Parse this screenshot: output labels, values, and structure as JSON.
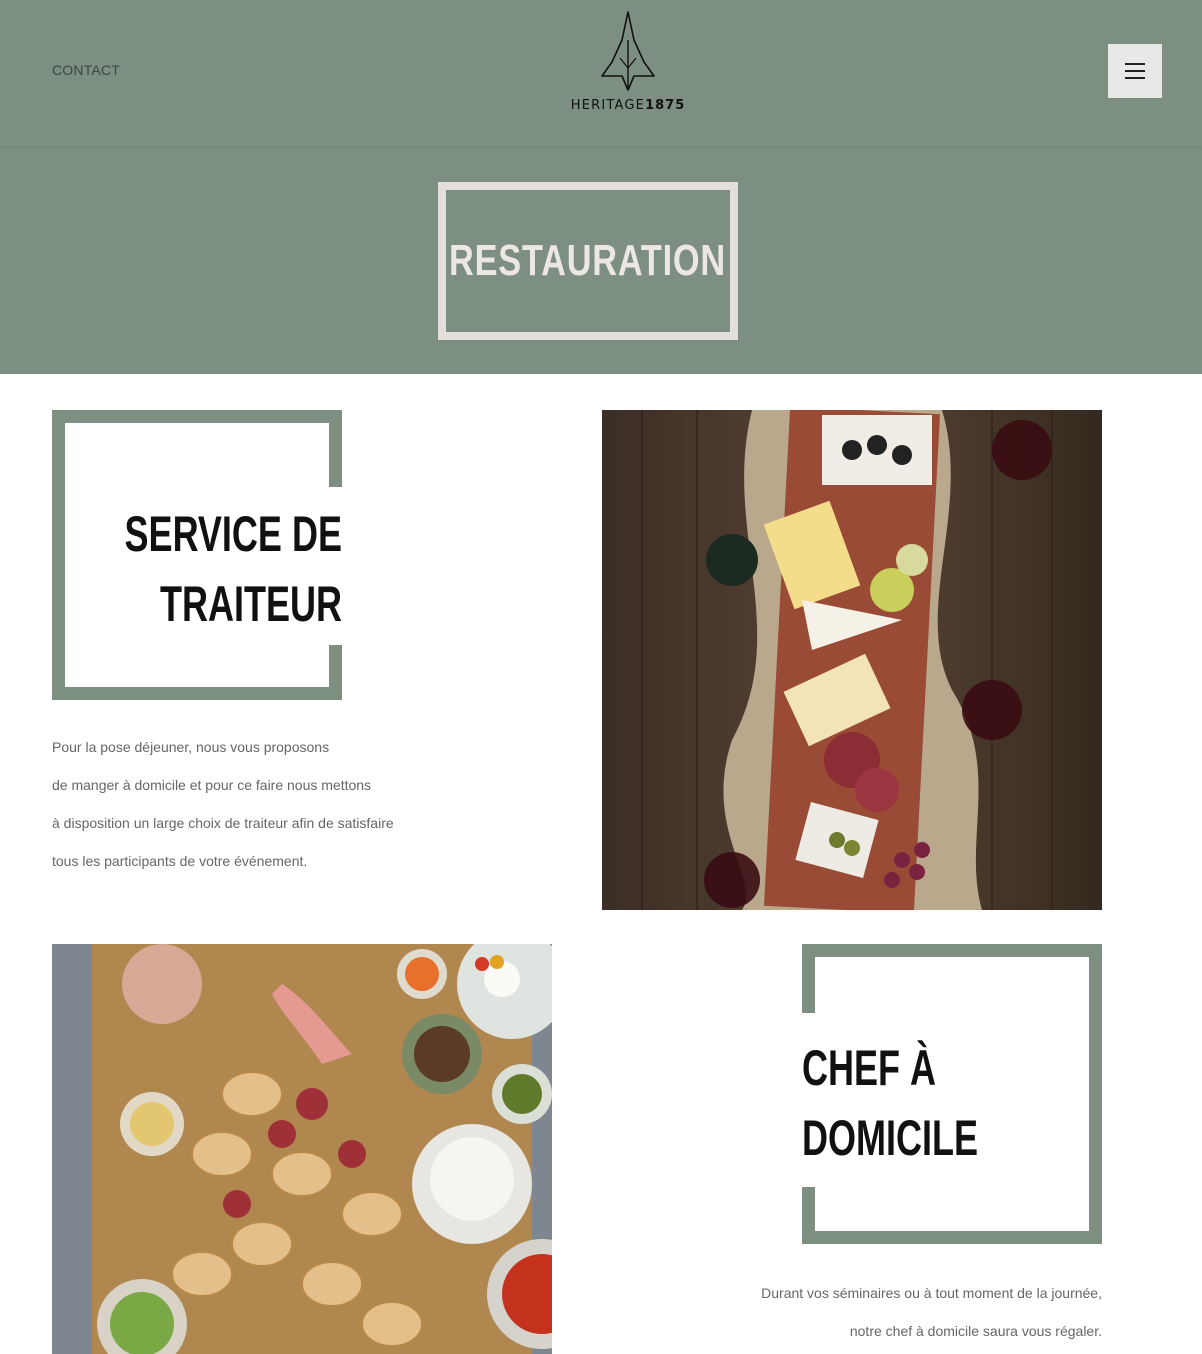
{
  "header": {
    "contact_label": "CONTACT",
    "logo_text_word": "HERITAGE",
    "logo_text_number": "1875",
    "menu_icon": "hamburger-menu-icon"
  },
  "banner": {
    "title": "RESTAURATION"
  },
  "sections": [
    {
      "title_line1": "SERVICE DE",
      "title_line2": "TRAITEUR",
      "paragraph_lines": [
        "Pour la pose déjeuner, nous vous proposons",
        "de manger à domicile et pour ce faire nous mettons",
        "à disposition un large choix de traiteur afin de satisfaire",
        "tous les participants de votre événement."
      ],
      "image": "charcuterie-board-photo"
    },
    {
      "title_line1": "CHEF À",
      "title_line2": "DOMICILE",
      "paragraph_lines": [
        "Durant vos séminaires ou à tout moment de la journée,",
        "notre chef à domicile saura vous régaler."
      ],
      "image": "antipasti-platter-photo"
    }
  ],
  "colors": {
    "sage": "#7d8f80",
    "banner_frame": "#e4dfdc",
    "text_muted": "#666666"
  }
}
